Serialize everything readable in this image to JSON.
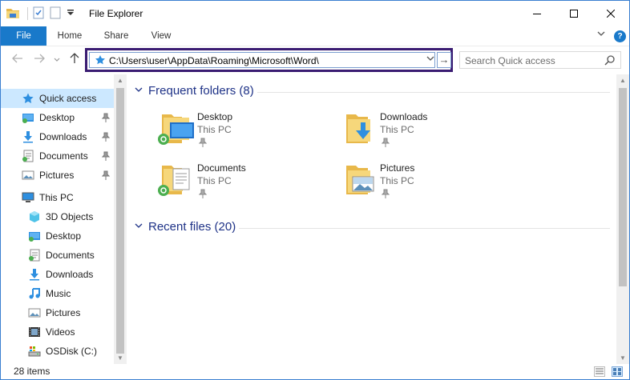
{
  "window": {
    "title": "File Explorer"
  },
  "ribbon": {
    "tabs": [
      "File",
      "Home",
      "Share",
      "View"
    ],
    "help_label": "?"
  },
  "address": {
    "path": "C:\\Users\\user\\AppData\\Roaming\\Microsoft\\Word\\",
    "go_label": "→"
  },
  "search": {
    "placeholder": "Search Quick access"
  },
  "sidebar": {
    "items": [
      {
        "label": "Quick access",
        "icon": "star-icon",
        "pinned": false,
        "selected": true
      },
      {
        "label": "Desktop",
        "icon": "desktop-folder-icon",
        "pinned": true
      },
      {
        "label": "Downloads",
        "icon": "downloads-icon",
        "pinned": true
      },
      {
        "label": "Documents",
        "icon": "documents-icon",
        "pinned": true
      },
      {
        "label": "Pictures",
        "icon": "pictures-icon",
        "pinned": true
      },
      {
        "label": "This PC",
        "icon": "pc-icon",
        "pinned": false
      },
      {
        "label": "3D Objects",
        "icon": "3d-objects-icon",
        "pinned": false
      },
      {
        "label": "Desktop",
        "icon": "desktop-folder-icon",
        "pinned": false
      },
      {
        "label": "Documents",
        "icon": "documents-icon",
        "pinned": false
      },
      {
        "label": "Downloads",
        "icon": "downloads-icon",
        "pinned": false
      },
      {
        "label": "Music",
        "icon": "music-icon",
        "pinned": false
      },
      {
        "label": "Pictures",
        "icon": "pictures-icon",
        "pinned": false
      },
      {
        "label": "Videos",
        "icon": "videos-icon",
        "pinned": false
      },
      {
        "label": "OSDisk (C:)",
        "icon": "disk-icon",
        "pinned": false
      }
    ]
  },
  "main": {
    "frequent_header": "Frequent folders (8)",
    "recent_header": "Recent files (20)",
    "folders": [
      {
        "name": "Desktop",
        "location": "This PC",
        "icon": "desktop-folder-icon"
      },
      {
        "name": "Downloads",
        "location": "This PC",
        "icon": "downloads-folder-icon"
      },
      {
        "name": "Documents",
        "location": "This PC",
        "icon": "documents-folder-icon"
      },
      {
        "name": "Pictures",
        "location": "This PC",
        "icon": "pictures-folder-icon"
      }
    ]
  },
  "status": {
    "item_count": "28 items"
  },
  "colors": {
    "accent": "#1979ca",
    "selection": "#cce8ff",
    "address_highlight": "#3a1c72",
    "group_header": "#1e3287"
  }
}
